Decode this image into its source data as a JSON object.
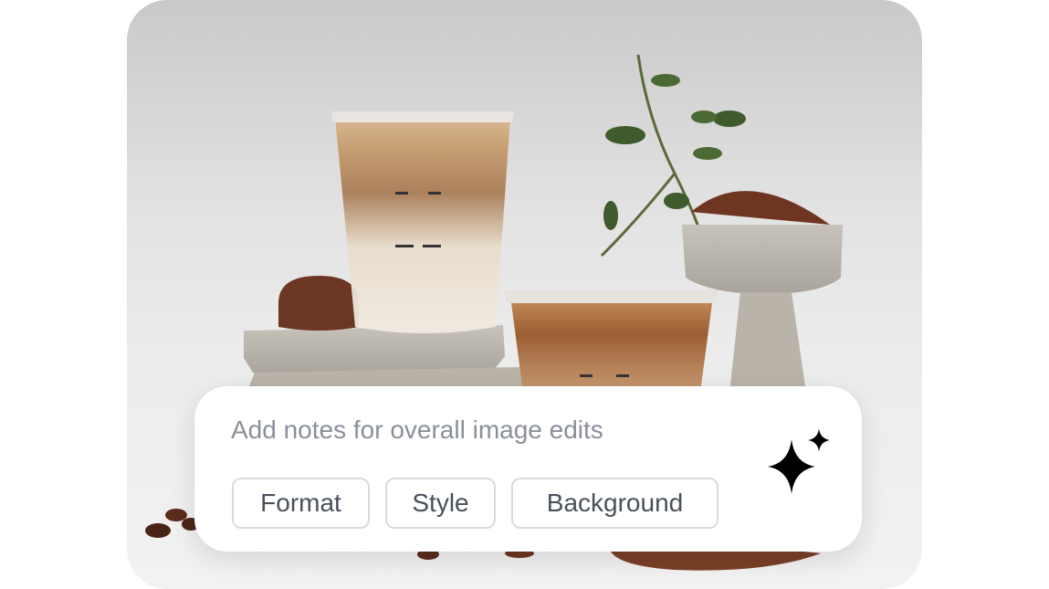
{
  "photo": {
    "description_icon": "coffee-product-photo",
    "background_color": "#e4e4e4"
  },
  "prompt": {
    "placeholder": "Add notes for overall image edits",
    "value": ""
  },
  "chips": [
    {
      "label": "Format"
    },
    {
      "label": "Style"
    },
    {
      "label": "Background"
    }
  ],
  "generate": {
    "icon": "sparkle-icon",
    "color": "#000000"
  }
}
